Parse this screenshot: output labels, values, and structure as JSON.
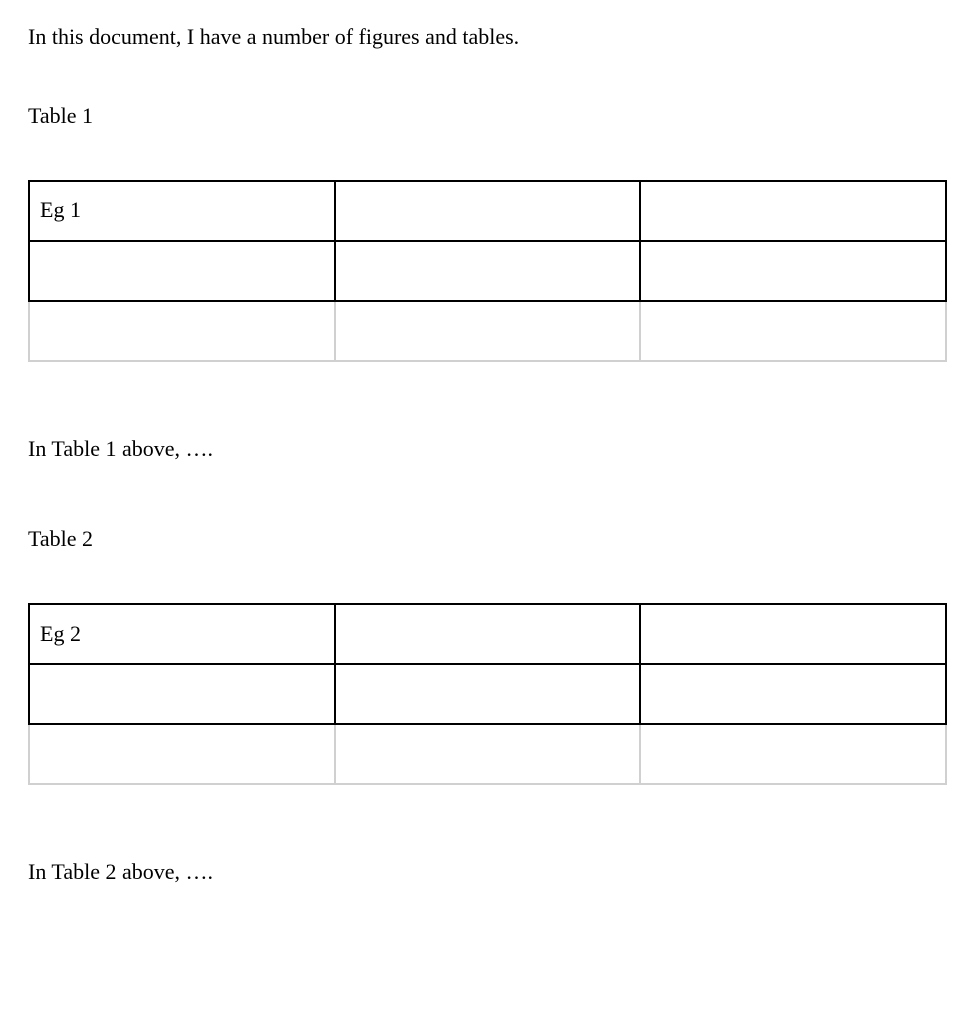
{
  "intro": "In this document, I have a number of figures and tables.",
  "sections": [
    {
      "caption": "Table 1",
      "table": {
        "rows": [
          {
            "cells": [
              "Eg 1",
              "",
              ""
            ],
            "style": "dark"
          },
          {
            "cells": [
              "",
              "",
              ""
            ],
            "style": "dark"
          },
          {
            "cells": [
              "",
              "",
              ""
            ],
            "style": "light"
          }
        ]
      },
      "after_text": "In Table 1 above, …."
    },
    {
      "caption": "Table 2",
      "table": {
        "rows": [
          {
            "cells": [
              "Eg 2",
              "",
              ""
            ],
            "style": "dark"
          },
          {
            "cells": [
              "",
              "",
              ""
            ],
            "style": "dark"
          },
          {
            "cells": [
              "",
              "",
              ""
            ],
            "style": "light"
          }
        ]
      },
      "after_text": "In Table 2 above, …."
    }
  ]
}
